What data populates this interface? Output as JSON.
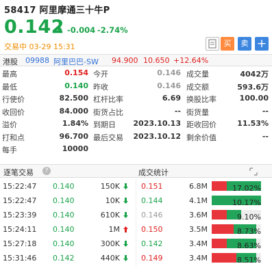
{
  "header": {
    "code_name": "58417  阿里摩通三十牛P",
    "price": "0.142",
    "change": "-0.004",
    "change_pct": "-2.74%",
    "status": "交易中 03-29 15:31",
    "buy_label": "买",
    "sell_label": "卖"
  },
  "underlying": {
    "market": "港股",
    "code": "09988",
    "name": "阿里巴巴-SW",
    "price": "94.900",
    "change": "10.650",
    "change_pct": "+12.64%"
  },
  "quote_rows": [
    [
      "最高",
      "0.154",
      "今开",
      "0.146",
      "成交量",
      "4042万"
    ],
    [
      "最低",
      "0.140",
      "昨收",
      "0.146",
      "成交额",
      "593.6万"
    ],
    [
      "行使价",
      "82.500",
      "杠杆比率",
      "6.69",
      "换股比率",
      "100.00"
    ],
    [
      "收回价",
      "84.000",
      "街货占比",
      "--",
      "街货量",
      "--"
    ],
    [
      "溢价",
      "1.84%",
      "到期日",
      "2023.10.13",
      "距收回价",
      "11.53%"
    ],
    [
      "打和点",
      "96.700",
      "最后交易",
      "2023.10.12",
      "剩余价值",
      "--"
    ],
    [
      "每手",
      "10000",
      "",
      "",
      "",
      ""
    ]
  ],
  "trades_header": {
    "left": "逐笔交易",
    "right": "成交统计"
  },
  "trades": [
    {
      "time": "15:22:47",
      "price": "0.140",
      "vol": "150K",
      "dir": "down",
      "sp": "0.151",
      "amt": "6.8M",
      "pct": "17.02%",
      "r": 0.3,
      "g": 0.7
    },
    {
      "time": "15:22:47",
      "price": "0.140",
      "vol": "10K",
      "dir": "down",
      "sp": "0.144",
      "amt": "4.1M",
      "pct": "10.17%",
      "r": 0.0,
      "g": 1.0
    },
    {
      "time": "15:23:39",
      "price": "0.140",
      "vol": "610K",
      "dir": "down",
      "sp": "0.146",
      "amt": "3.6M",
      "pct": "9.10%",
      "r": 0.3,
      "g": 0.3
    },
    {
      "time": "15:24:11",
      "price": "0.140",
      "vol": "1M",
      "dir": "up",
      "sp": "0.150",
      "amt": "3.5M",
      "pct": "8.73%",
      "r": 0.45,
      "g": 0.45
    },
    {
      "time": "15:27:18",
      "price": "0.140",
      "vol": "300K",
      "dir": "down",
      "sp": "0.142",
      "amt": "3.4M",
      "pct": "8.63%",
      "r": 0.3,
      "g": 0.6
    },
    {
      "time": "15:31:46",
      "price": "0.142",
      "vol": "440K",
      "dir": "down",
      "sp": "0.149",
      "amt": "3.4M",
      "pct": "8.51%",
      "r": 0.5,
      "g": 0.4
    }
  ]
}
